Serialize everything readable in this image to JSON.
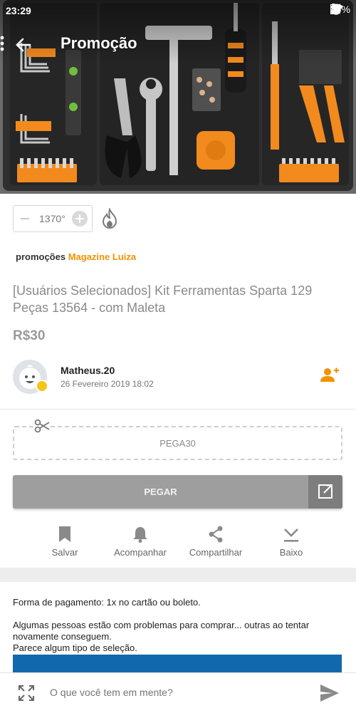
{
  "status_bar": {
    "time": "23:29",
    "battery": "37%"
  },
  "app_bar": {
    "title": "Promoção",
    "back_icon": "arrow-back-icon",
    "menu_icon": "more-vertical-icon"
  },
  "vote": {
    "count": "1370°",
    "minus_icon": "minus-icon",
    "plus_icon": "plus-icon",
    "hot_icon": "fire-icon"
  },
  "store": {
    "prefix": "promoções",
    "name": "Magazine Luiza",
    "name_color": "#f39200"
  },
  "deal": {
    "title": "[Usuários Selecionados] Kit Ferramentas Sparta 129 Peças 13564 - com Maleta",
    "price": "R$30"
  },
  "author": {
    "name": "Matheus.20",
    "date": "26 Fevereiro 2019 18:02",
    "follow_icon": "add-person-icon"
  },
  "coupon": {
    "code": "PEGA30",
    "icon": "scissors-icon"
  },
  "get_button": {
    "label": "PEGAR",
    "icon": "open-external-icon"
  },
  "actions": [
    {
      "label": "Salvar",
      "icon": "bookmark-icon"
    },
    {
      "label": "Acompanhar",
      "icon": "bell-icon"
    },
    {
      "label": "Compartilhar",
      "icon": "share-icon"
    },
    {
      "label": "Baixo",
      "icon": "chevron-down-icon"
    }
  ],
  "description": {
    "payment": "Forma de pagamento: 1x no cartão ou boleto.",
    "line1": "Algumas pessoas estão com problemas para comprar... outras ao tentar novamente conseguem.",
    "line2": "Parece algum tipo de seleção."
  },
  "comment_bar": {
    "placeholder": "O que você tem em mente?",
    "expand_icon": "expand-icon",
    "send_icon": "send-icon"
  },
  "colors": {
    "accent": "#f39200",
    "button_gray": "#9e9e9e",
    "blue_block": "#1168ad"
  }
}
